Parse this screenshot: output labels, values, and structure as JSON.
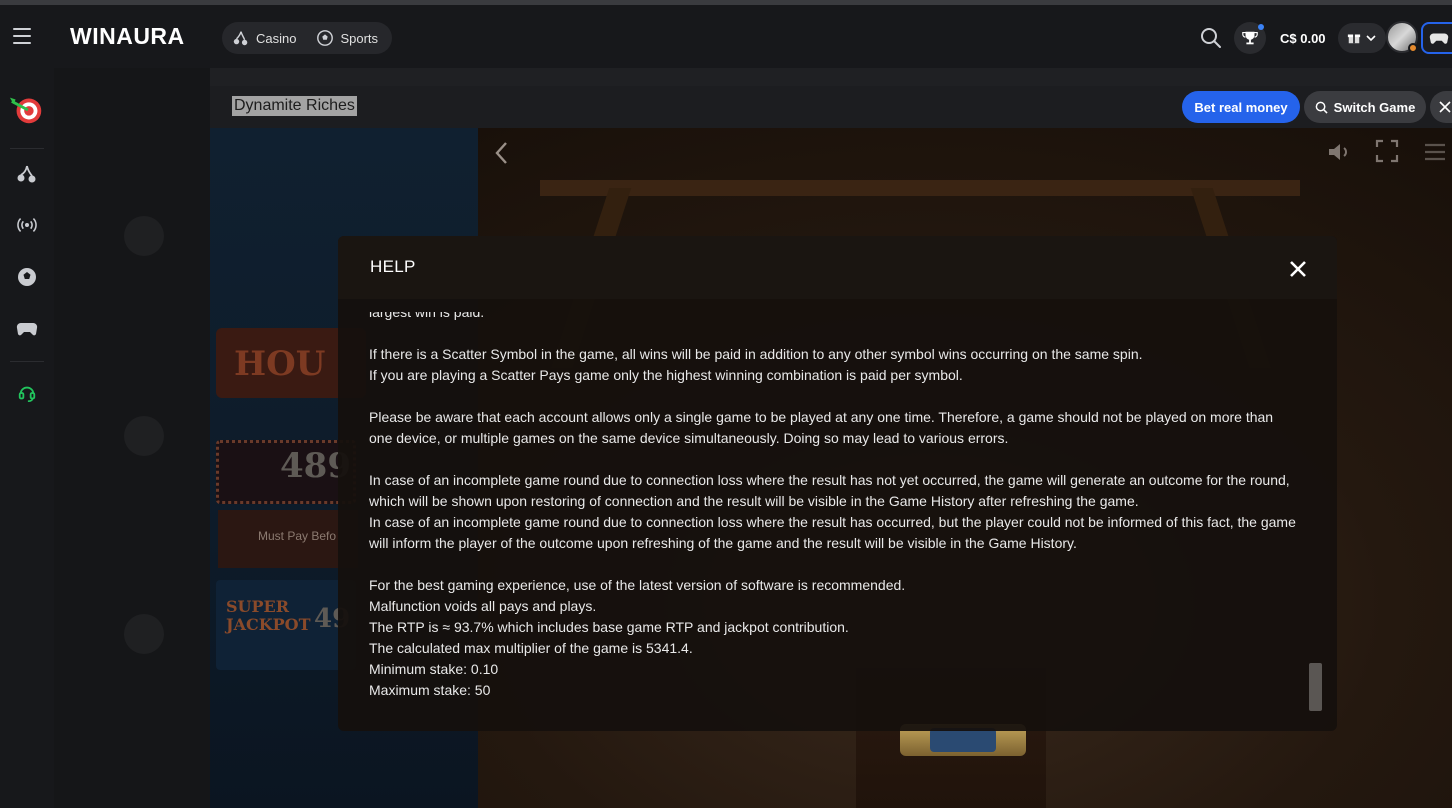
{
  "header": {
    "logo_text": "WINAURA",
    "nav": [
      {
        "label": "Casino",
        "icon": "cherries-icon"
      },
      {
        "label": "Sports",
        "icon": "soccer-ball-icon"
      }
    ],
    "balance": "C$ 0.00"
  },
  "rail": {
    "items": [
      "darts-target-icon",
      "cherries-icon",
      "live-broadcast-icon",
      "soccer-ball-icon",
      "gamepad-icon",
      "headset-icon"
    ]
  },
  "game_bar": {
    "title": "Dynamite Riches",
    "bet_real_money": "Bet real money",
    "switch_game": "Switch Game"
  },
  "game_panel": {
    "sign_text": "HOU",
    "amount_text": "489",
    "must_pay_text": "Must Pay Befo",
    "super_label": "SUPER",
    "jackpot_label": "JACKPOT",
    "super_amount": "49"
  },
  "help_modal": {
    "title": "HELP",
    "paragraphs": [
      [
        "largest win is paid."
      ],
      [
        "If there is a Scatter Symbol in the game, all wins will be paid in addition to any other symbol wins occurring on the same spin.",
        "If you are playing a Scatter Pays game only the highest winning combination is paid per symbol."
      ],
      [
        "Please be aware that each account allows only a single game to be played at any one time. Therefore, a game should not be played on more than one device, or multiple games on the same device simultaneously. Doing so may lead to various errors."
      ],
      [
        "In case of an incomplete game round due to connection loss where the result has not yet occurred, the game will generate an outcome for the round, which will be shown upon restoring of connection and the result will be visible in the Game History after refreshing the game.",
        "In case of an incomplete game round due to connection loss where the result has occurred, but the player could not be informed of this fact, the game will inform the player of the outcome upon refreshing of the game and the result will be visible in the Game History."
      ],
      [
        "For the best gaming experience, use of the latest version of software is recommended.",
        "Malfunction voids all pays and plays.",
        "The RTP is ≈ 93.7% which includes base game RTP and jackpot contribution.",
        "The calculated max multiplier of the game is 5341.4.",
        "Minimum stake: 0.10",
        "Maximum stake: 50"
      ]
    ]
  },
  "colors": {
    "accent_blue": "#2563eb",
    "rail_active_green": "#22c55e",
    "modal_bg": "#15100d"
  }
}
